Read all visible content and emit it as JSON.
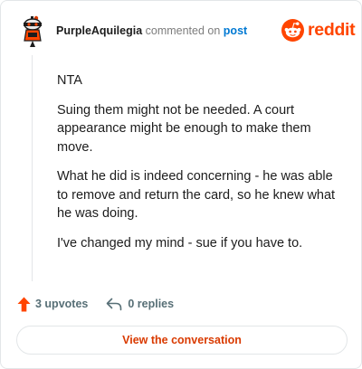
{
  "header": {
    "username": "PurpleAquilegia",
    "action_text": " commented on ",
    "post_link": "post",
    "brand": "reddit"
  },
  "comment": {
    "paragraphs": [
      "NTA",
      "Suing them might not be needed. A court appearance might be enough to make them move.",
      "What he did is indeed concerning - he was able to remove and return the card, so he knew what he was doing.",
      "I've changed my mind - sue if you have to."
    ]
  },
  "footer": {
    "upvotes": "3 upvotes",
    "replies": "0 replies"
  },
  "cta": {
    "label": "View the conversation"
  },
  "colors": {
    "brand": "#ff4500",
    "link": "#0079d3",
    "cta_text": "#d93a00",
    "muted": "#576f76"
  },
  "icons": {
    "avatar": "snoo-avatar-icon",
    "logo": "reddit-snoo-icon",
    "upvote": "upvote-arrow-icon",
    "reply": "reply-arrow-icon"
  }
}
